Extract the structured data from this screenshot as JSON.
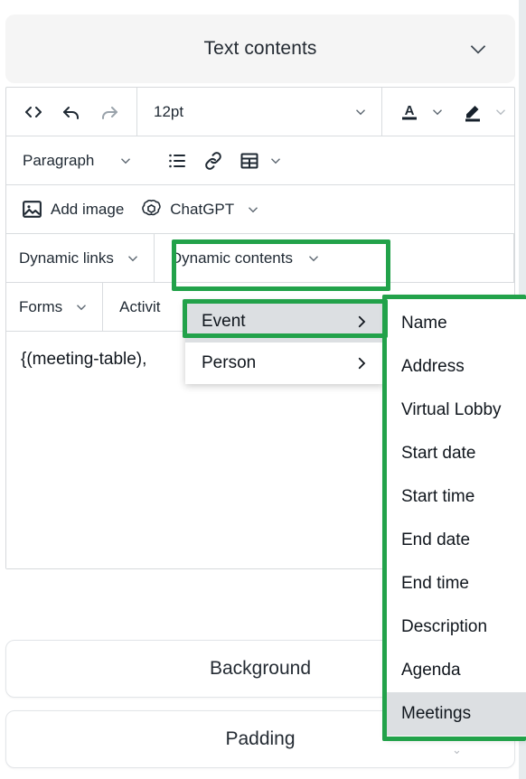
{
  "header": {
    "title": "Text contents",
    "collapse_icon": "chevron-down-icon"
  },
  "toolbar": {
    "row1": {
      "source_code_icon": "code-icon",
      "undo_icon": "undo-icon",
      "redo_icon": "redo-icon",
      "font_size_value": "12pt",
      "font_size_caret": "chevron-down-icon",
      "text_color_icon": "font-color-icon",
      "text_color_caret": "chevron-down-icon",
      "highlight_icon": "highlight-pen-icon",
      "highlight_caret": "chevron-down-icon"
    },
    "row2": {
      "block_format_value": "Paragraph",
      "block_format_caret": "chevron-down-icon",
      "bullet_list_icon": "bullet-list-icon",
      "link_icon": "link-icon",
      "table_icon": "table-icon",
      "table_caret": "chevron-down-icon"
    },
    "row3": {
      "add_image_label": "Add image",
      "add_image_icon": "image-icon",
      "chatgpt_label": "ChatGPT",
      "chatgpt_icon": "chatgpt-icon",
      "chatgpt_caret": "chevron-down-icon"
    },
    "row4": {
      "dynamic_links_label": "Dynamic links",
      "dynamic_links_caret": "chevron-down-icon",
      "dynamic_contents_label": "Dynamic contents",
      "dynamic_contents_caret": "chevron-down-icon"
    },
    "row5": {
      "forms_label": "Forms",
      "forms_caret": "chevron-down-icon",
      "activities_label": "Activit"
    }
  },
  "editor_body": {
    "content": "{(meeting-table),"
  },
  "dynamic_contents_menu": {
    "items": [
      {
        "label": "Event",
        "has_submenu": true,
        "active": true,
        "arrow": "chevron-right-icon"
      },
      {
        "label": "Person",
        "has_submenu": true,
        "active": false,
        "arrow": "chevron-right-icon"
      }
    ]
  },
  "event_submenu": {
    "items": [
      {
        "label": "Name",
        "active": false
      },
      {
        "label": "Address",
        "active": false
      },
      {
        "label": "Virtual Lobby",
        "active": false
      },
      {
        "label": "Start date",
        "active": false
      },
      {
        "label": "Start time",
        "active": false
      },
      {
        "label": "End date",
        "active": false
      },
      {
        "label": "End time",
        "active": false
      },
      {
        "label": "Description",
        "active": false
      },
      {
        "label": "Agenda",
        "active": false
      },
      {
        "label": "Meetings",
        "active": true
      }
    ]
  },
  "sections": [
    {
      "label": "Background"
    },
    {
      "label": "Padding"
    }
  ],
  "annotations": {
    "highlight_color": "#22a24a",
    "boxes": [
      {
        "name": "dynamic-contents-button"
      },
      {
        "name": "event-menu-item"
      },
      {
        "name": "event-submenu"
      }
    ]
  },
  "colors": {
    "accent_green": "#22a24a",
    "panel_gray": "#f5f5f5",
    "menu_hover": "#dcdfe2",
    "text_primary": "#1f2933",
    "border": "#d9dcdf"
  }
}
